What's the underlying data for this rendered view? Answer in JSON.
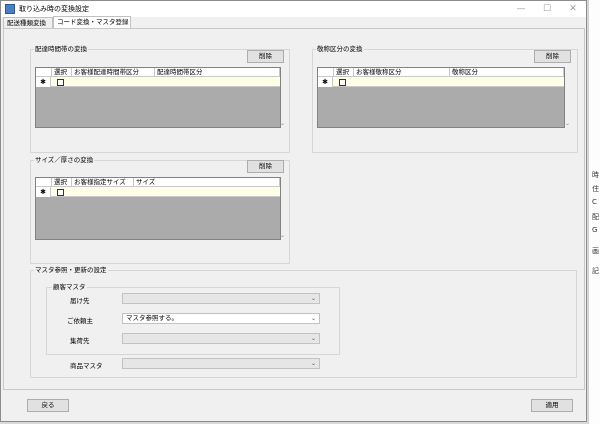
{
  "window": {
    "title": "取り込み時の変換設定",
    "minimize_glyph": "—",
    "maximize_glyph": "☐",
    "close_glyph": "✕"
  },
  "tabs": [
    {
      "label": "配送種類変換",
      "active": false
    },
    {
      "label": "コード変換・マスタ登録",
      "active": true
    }
  ],
  "delivery_time": {
    "title": "配達時間帯の変換",
    "delete_label": "削除",
    "columns": [
      "選択",
      "お客様配達時間帯区分",
      "配達時間帯区分"
    ]
  },
  "billing": {
    "title": "敬称区分の変換",
    "delete_label": "削除",
    "columns": [
      "選択",
      "お客様敬称区分",
      "敬称区分"
    ]
  },
  "size": {
    "title": "サイズ／厚さの変換",
    "delete_label": "削除",
    "columns": [
      "選択",
      "お客様指定サイズ",
      "サイズ"
    ]
  },
  "grid_common": {
    "new_row_marker": "✱",
    "scroll_down_glyph": "⌄"
  },
  "master": {
    "title": "マスタ参照・更新の設定",
    "customer_master": {
      "title": "顧客マスタ",
      "fields": [
        {
          "label": "届け先",
          "value": ""
        },
        {
          "label": "ご依頼主",
          "value": "マスタ参照する。"
        },
        {
          "label": "集荷先",
          "value": ""
        }
      ]
    },
    "product_master": {
      "label": "商品マスタ",
      "value": ""
    },
    "dropdown_glyph": "⌄"
  },
  "footer": {
    "back_label": "戻る",
    "apply_label": "適用"
  },
  "background_chars": [
    "時",
    "住",
    "C",
    "配",
    "G",
    "画",
    "記"
  ]
}
